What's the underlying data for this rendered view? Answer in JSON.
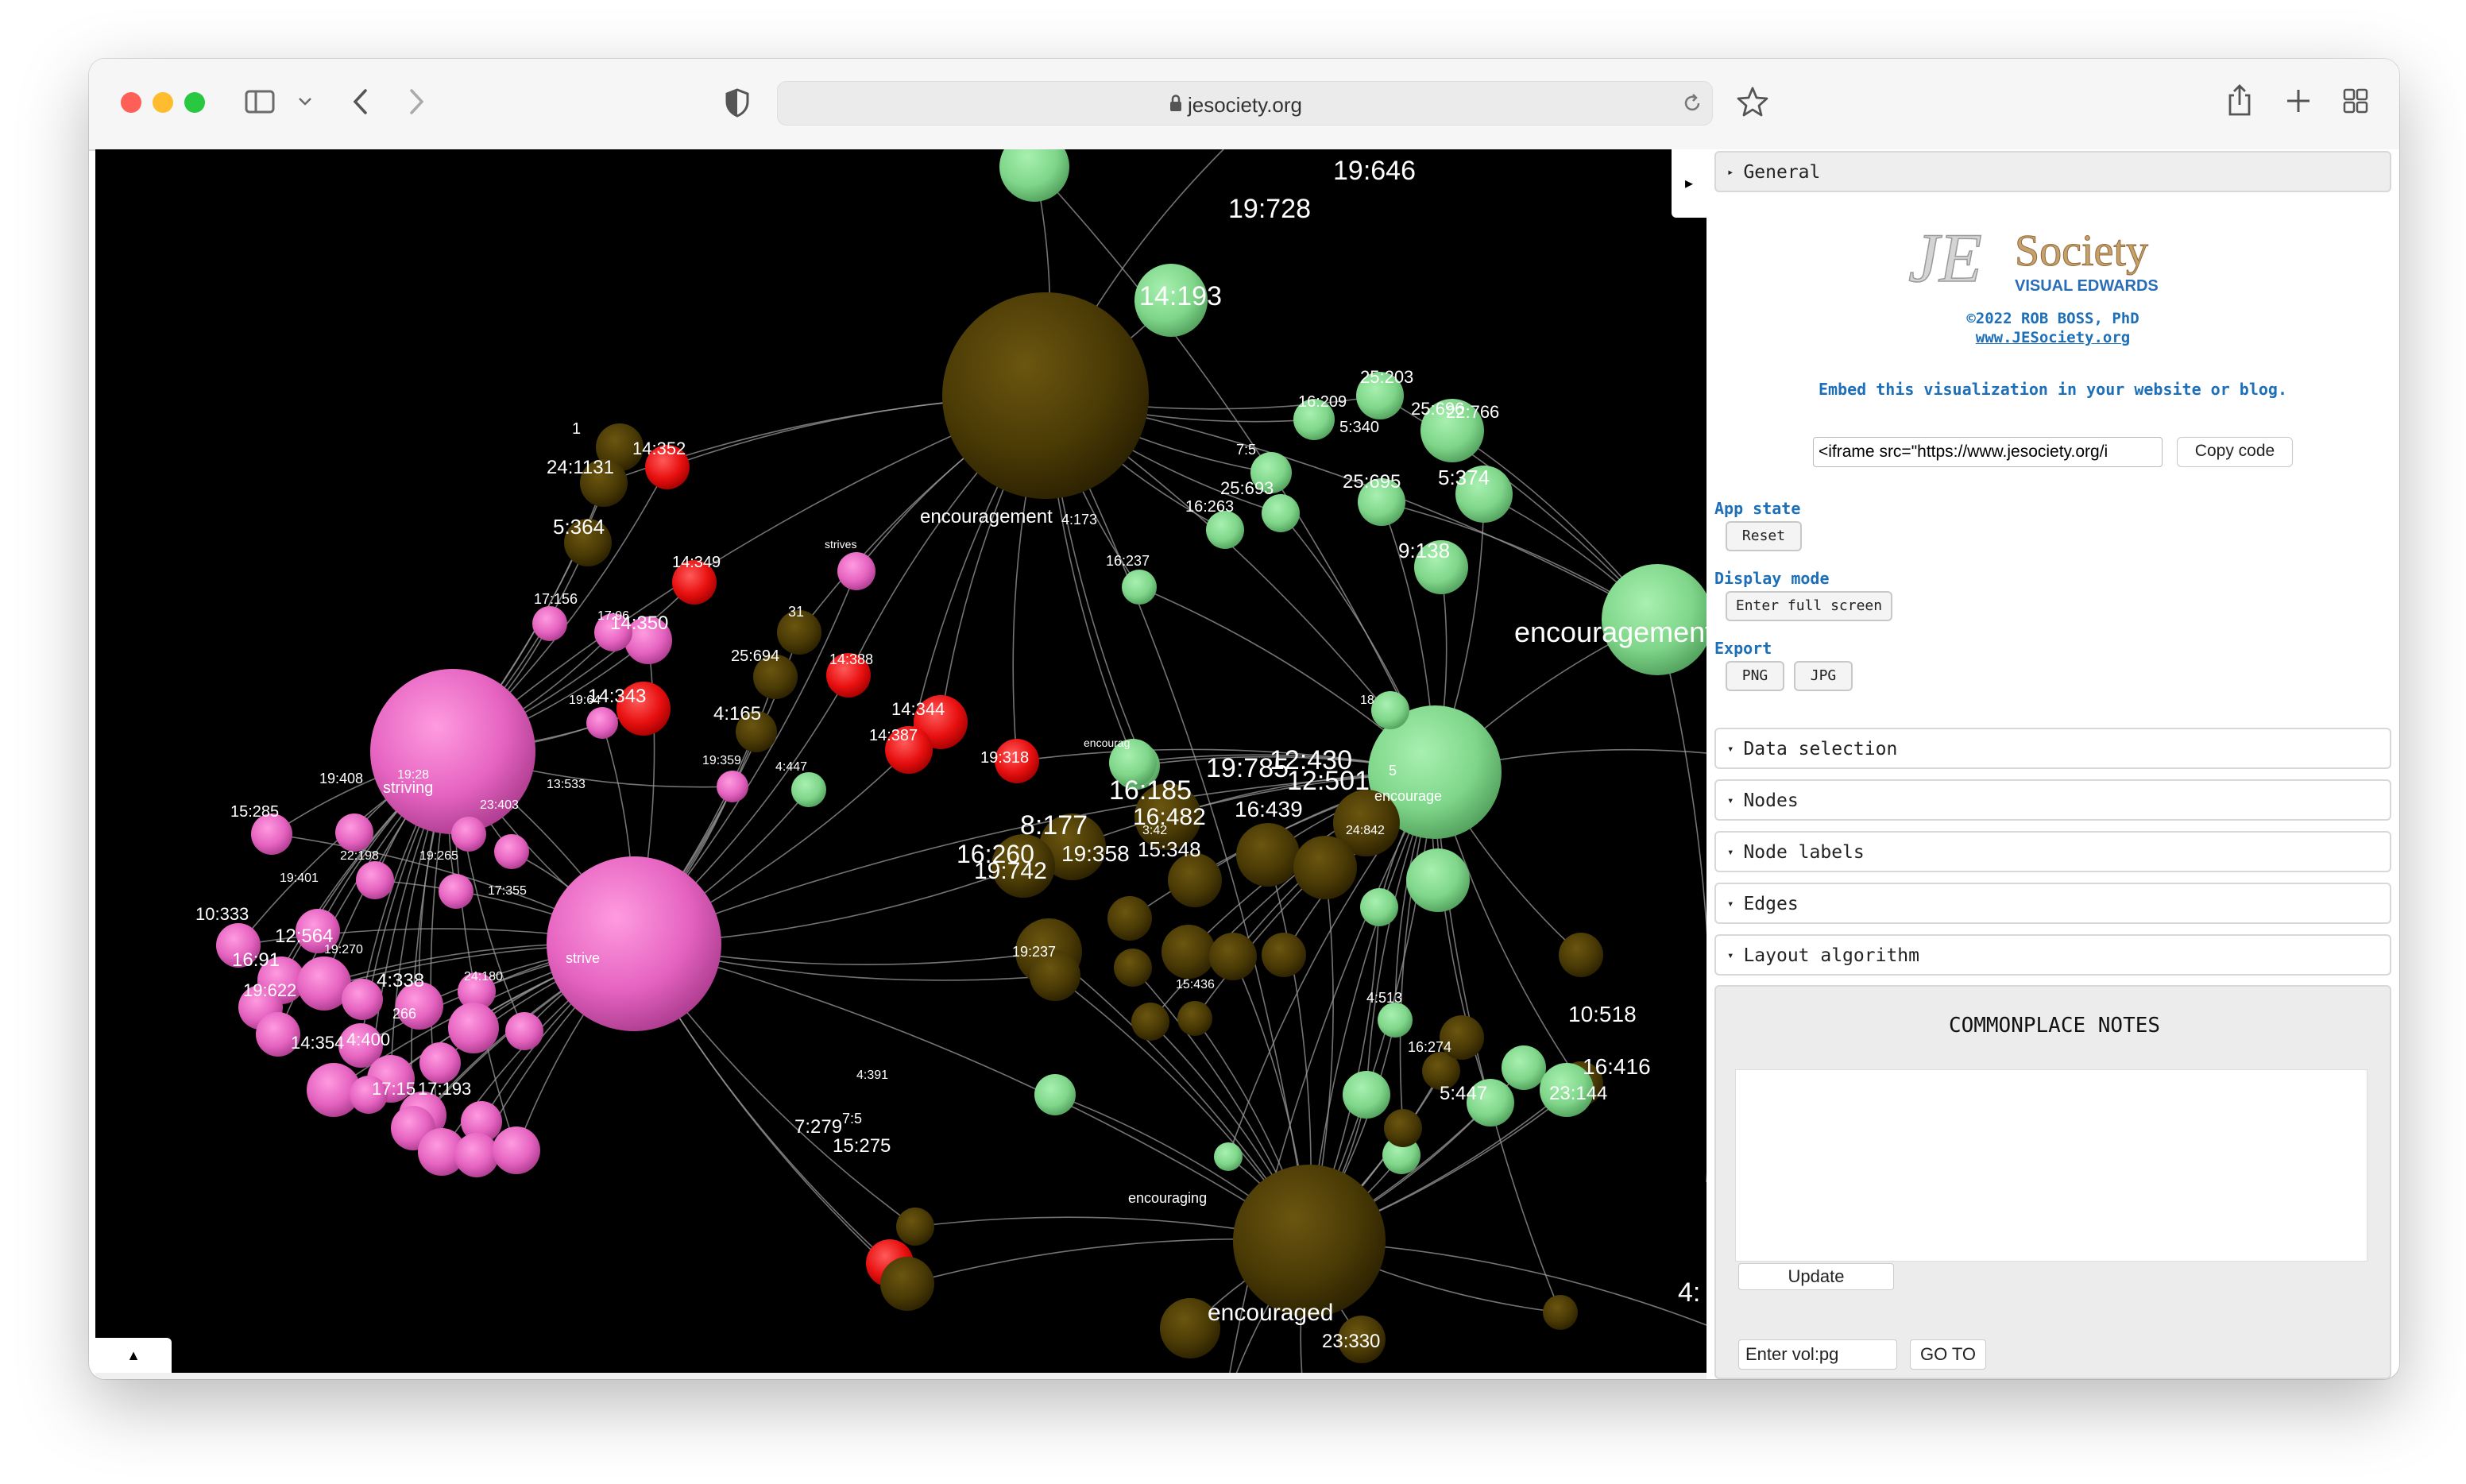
{
  "browser": {
    "url": "jesociety.org"
  },
  "logo": {
    "main": "JE Society",
    "sub": "VISUAL EDWARDS"
  },
  "credits": {
    "copyright": "©2022 ROB BOSS, PhD",
    "website": "www.JESociety.org"
  },
  "embed": {
    "caption": "Embed this visualization in your website or blog.",
    "code_value": "<iframe src=\"https://www.jesociety.org/i",
    "copy_label": "Copy code"
  },
  "panel": {
    "general_label": "General",
    "app_state_label": "App state",
    "reset_label": "Reset",
    "display_mode_label": "Display mode",
    "fullscreen_label": "Enter full screen",
    "export_label": "Export",
    "png_label": "PNG",
    "jpg_label": "JPG",
    "sections": [
      "Data selection",
      "Nodes",
      "Node labels",
      "Edges",
      "Layout algorithm"
    ]
  },
  "notes": {
    "title": "COMMONPLACE NOTES",
    "update_label": "Update",
    "goto_placeholder": "Enter vol:pg",
    "goto_label": "GO TO"
  },
  "colors": {
    "pink": "#ea6fc6",
    "olive": "#4a3a05",
    "green": "#7fd68a",
    "red": "#e81010",
    "edge": "#9a9a9a"
  },
  "graph": {
    "labels": [
      "19:646",
      "19:728",
      "14:193",
      "16:209",
      "25:203",
      "25:696",
      "22:766",
      "5:340",
      "7:5",
      "25:693",
      "25:695",
      "5:374",
      "16:263",
      "9:138",
      "encouragement",
      "encouragement",
      "4:173",
      "16:237",
      "1",
      "24:1131",
      "14:352",
      "5:364",
      "14:349",
      "strives",
      "17:156",
      "17:96",
      "14:350",
      "31",
      "25:694",
      "14:388",
      "19:64",
      "14:343",
      "14:344",
      "14:387",
      "4:165",
      "19:359",
      "4:447",
      "19:318",
      "encourag",
      "19:408",
      "19:28",
      "striving",
      "13:533",
      "23:403",
      "15:285",
      "22:198",
      "19:265",
      "19:401",
      "17:355",
      "10:333",
      "12:564",
      "19:270",
      "16:91",
      "4:338",
      "24:180",
      "19:622",
      "266",
      "14:354",
      "4:400",
      "17:15",
      "17:193",
      "strive",
      "16:185",
      "16:482",
      "3:42",
      "8:177",
      "16:260",
      "19:742",
      "19:358",
      "15:348",
      "19:785",
      "12:430",
      "12:501",
      "16:439",
      "encourage",
      "24:842",
      "5",
      "18",
      "19:237",
      "15:436",
      "4:513",
      "16:274",
      "10:518",
      "16:416",
      "5:447",
      "23:144",
      "4:391",
      "7:279",
      "7:5",
      "15:275",
      "encouraging",
      "encouraged",
      "23:330",
      "4:"
    ]
  }
}
